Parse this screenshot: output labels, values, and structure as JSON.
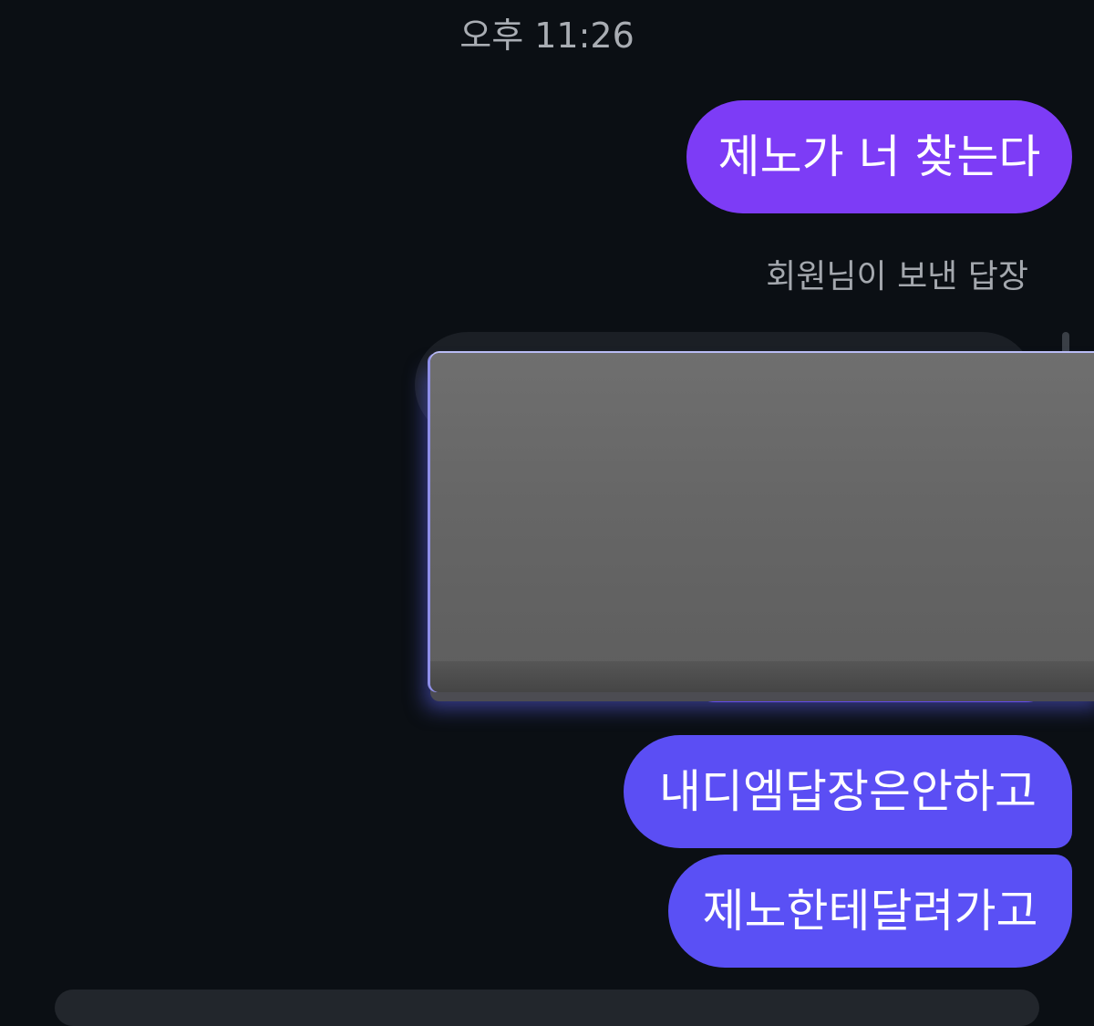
{
  "timestamp": "오후 11:26",
  "messages": [
    {
      "text": "제노가 너 찾는다"
    },
    {
      "text": "내디엠답장은안하고"
    },
    {
      "text": "제노한테달려가고"
    }
  ],
  "reply_label": "회원님이 보낸 답장",
  "colors": {
    "background": "#0b0f14",
    "bubble_purple": "#7d3cf6",
    "bubble_indigo": "#5b4ef4",
    "reply_bubble": "#1b1f25",
    "censor_box": "#666666"
  }
}
